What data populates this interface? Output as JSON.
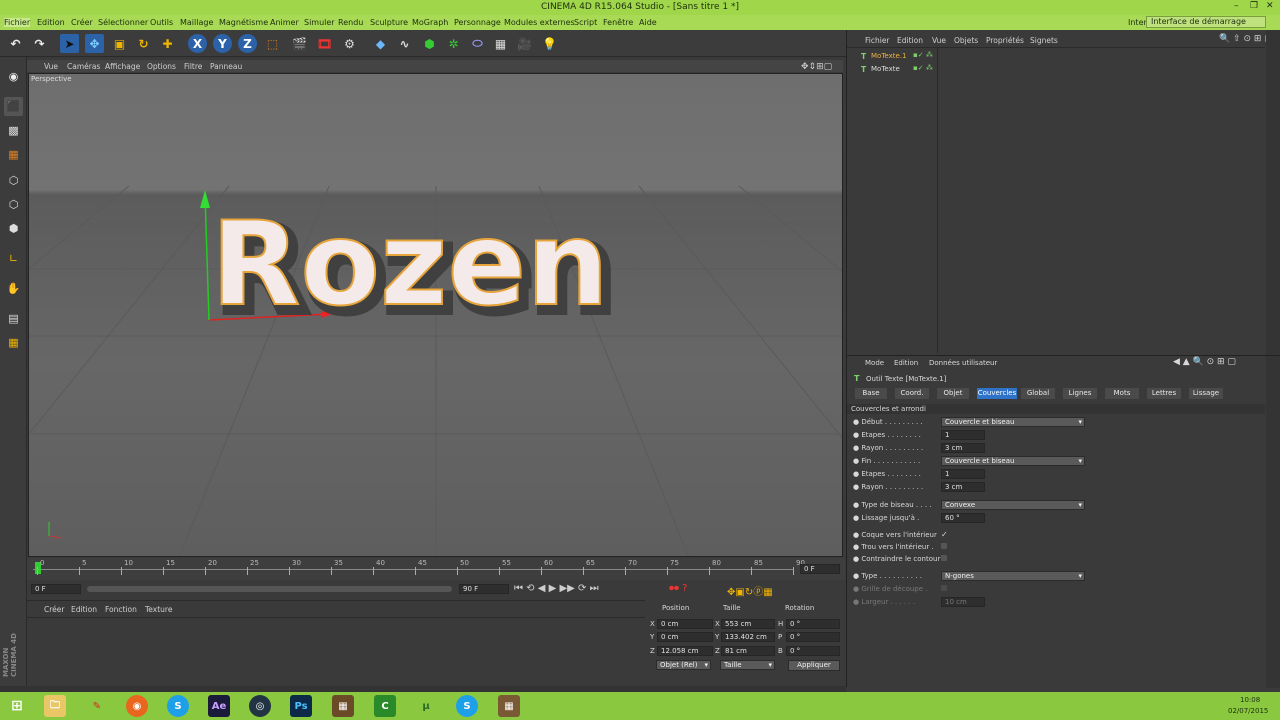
{
  "window": {
    "title": "CINEMA 4D R15.064 Studio - [Sans titre 1 *]",
    "controls": [
      "–",
      "❐",
      "✕"
    ]
  },
  "menu": {
    "items": [
      "Fichier",
      "Edition",
      "Créer",
      "Sélectionner",
      "Outils",
      "Maillage",
      "Magnétisme",
      "Animer",
      "Simuler",
      "Rendu",
      "Sculpture",
      "MoGraph",
      "Personnage",
      "Modules externes",
      "Script",
      "Fenêtre",
      "Aide"
    ],
    "interface_label": "Interface:",
    "interface_value": "Interface de démarrage"
  },
  "viewport": {
    "menu": [
      "Vue",
      "Caméras",
      "Affichage",
      "Options",
      "Filtre",
      "Panneau"
    ],
    "label": "Perspective",
    "text3d": "Rozen"
  },
  "timeline": {
    "ticks": [
      "0",
      "5",
      "10",
      "15",
      "20",
      "25",
      "30",
      "35",
      "40",
      "45",
      "50",
      "55",
      "60",
      "65",
      "70",
      "75",
      "80",
      "85",
      "90"
    ],
    "frame_end_label": "0 F",
    "start_field": "0 F",
    "end_field": "90 F",
    "range_field": "90 F"
  },
  "material": {
    "menu": [
      "Créer",
      "Edition",
      "Fonction",
      "Texture"
    ]
  },
  "coords": {
    "headers": [
      "Position",
      "Taille",
      "Rotation"
    ],
    "rows": [
      {
        "a": "X",
        "pos": "0 cm",
        "b": "X",
        "size": "553 cm",
        "c": "H",
        "rot": "0 °"
      },
      {
        "a": "Y",
        "pos": "0 cm",
        "b": "Y",
        "size": "133.402 cm",
        "c": "P",
        "rot": "0 °"
      },
      {
        "a": "Z",
        "pos": "12.058 cm",
        "b": "Z",
        "size": "81 cm",
        "c": "B",
        "rot": "0 °"
      }
    ],
    "mode": "Objet (Rel)",
    "size_mode": "Taille",
    "apply": "Appliquer"
  },
  "objects": {
    "menu": [
      "Fichier",
      "Edition",
      "Vue",
      "Objets",
      "Propriétés",
      "Signets"
    ],
    "items": [
      "MoTexte.1",
      "MoTexte"
    ]
  },
  "attributes": {
    "menu": [
      "Mode",
      "Edition",
      "Données utilisateur"
    ],
    "title": "Outil Texte [MoTexte.1]",
    "tabs": [
      "Base",
      "Coord.",
      "Objet",
      "Couvercles",
      "Global",
      "Lignes",
      "Mots",
      "Lettres",
      "Lissage"
    ],
    "selected_tab": "Couvercles",
    "section": "Couvercles et arrondi",
    "debut_label": "Début",
    "debut_value": "Couvercle et biseau",
    "etapes1_label": "Etapes",
    "etapes1_value": "1",
    "rayon1_label": "Rayon",
    "rayon1_value": "3 cm",
    "fin_label": "Fin",
    "fin_value": "Couvercle et biseau",
    "etapes2_label": "Etapes",
    "etapes2_value": "1",
    "rayon2_label": "Rayon",
    "rayon2_value": "3 cm",
    "type_biseau_label": "Type de biseau",
    "type_biseau_value": "Convexe",
    "lissage_label": "Lissage jusqu'à",
    "lissage_value": "60 °",
    "coque_label": "Coque vers l'intérieur",
    "coque_check": "✓",
    "trou_label": "Trou vers l'intérieur",
    "contraindre_label": "Contraindre le contour",
    "type_label": "Type",
    "type_value": "N-gones",
    "grille_label": "Grille de découpe",
    "largeur_label": "Largeur",
    "largeur_value": "10 cm"
  },
  "brand": {
    "line1": "MAXON",
    "line2": "CINEMA 4D"
  },
  "taskbar": {
    "icons": [
      "windows-icon",
      "explorer-icon",
      "tool-icon",
      "firefox-icon",
      "skype-icon",
      "aftereffects-icon",
      "cinema4d-icon",
      "photoshop-icon",
      "minecraft-icon",
      "camtasia-icon",
      "torrent-icon",
      "skype2-icon",
      "block-icon"
    ],
    "ae": "Ae",
    "ps": "Ps",
    "time": "10:08",
    "date": "02/07/2015"
  },
  "colors": {
    "title_bar": "#9fd64a",
    "accent_tab": "#2f73c8",
    "taskbar": "#8ac93f"
  }
}
